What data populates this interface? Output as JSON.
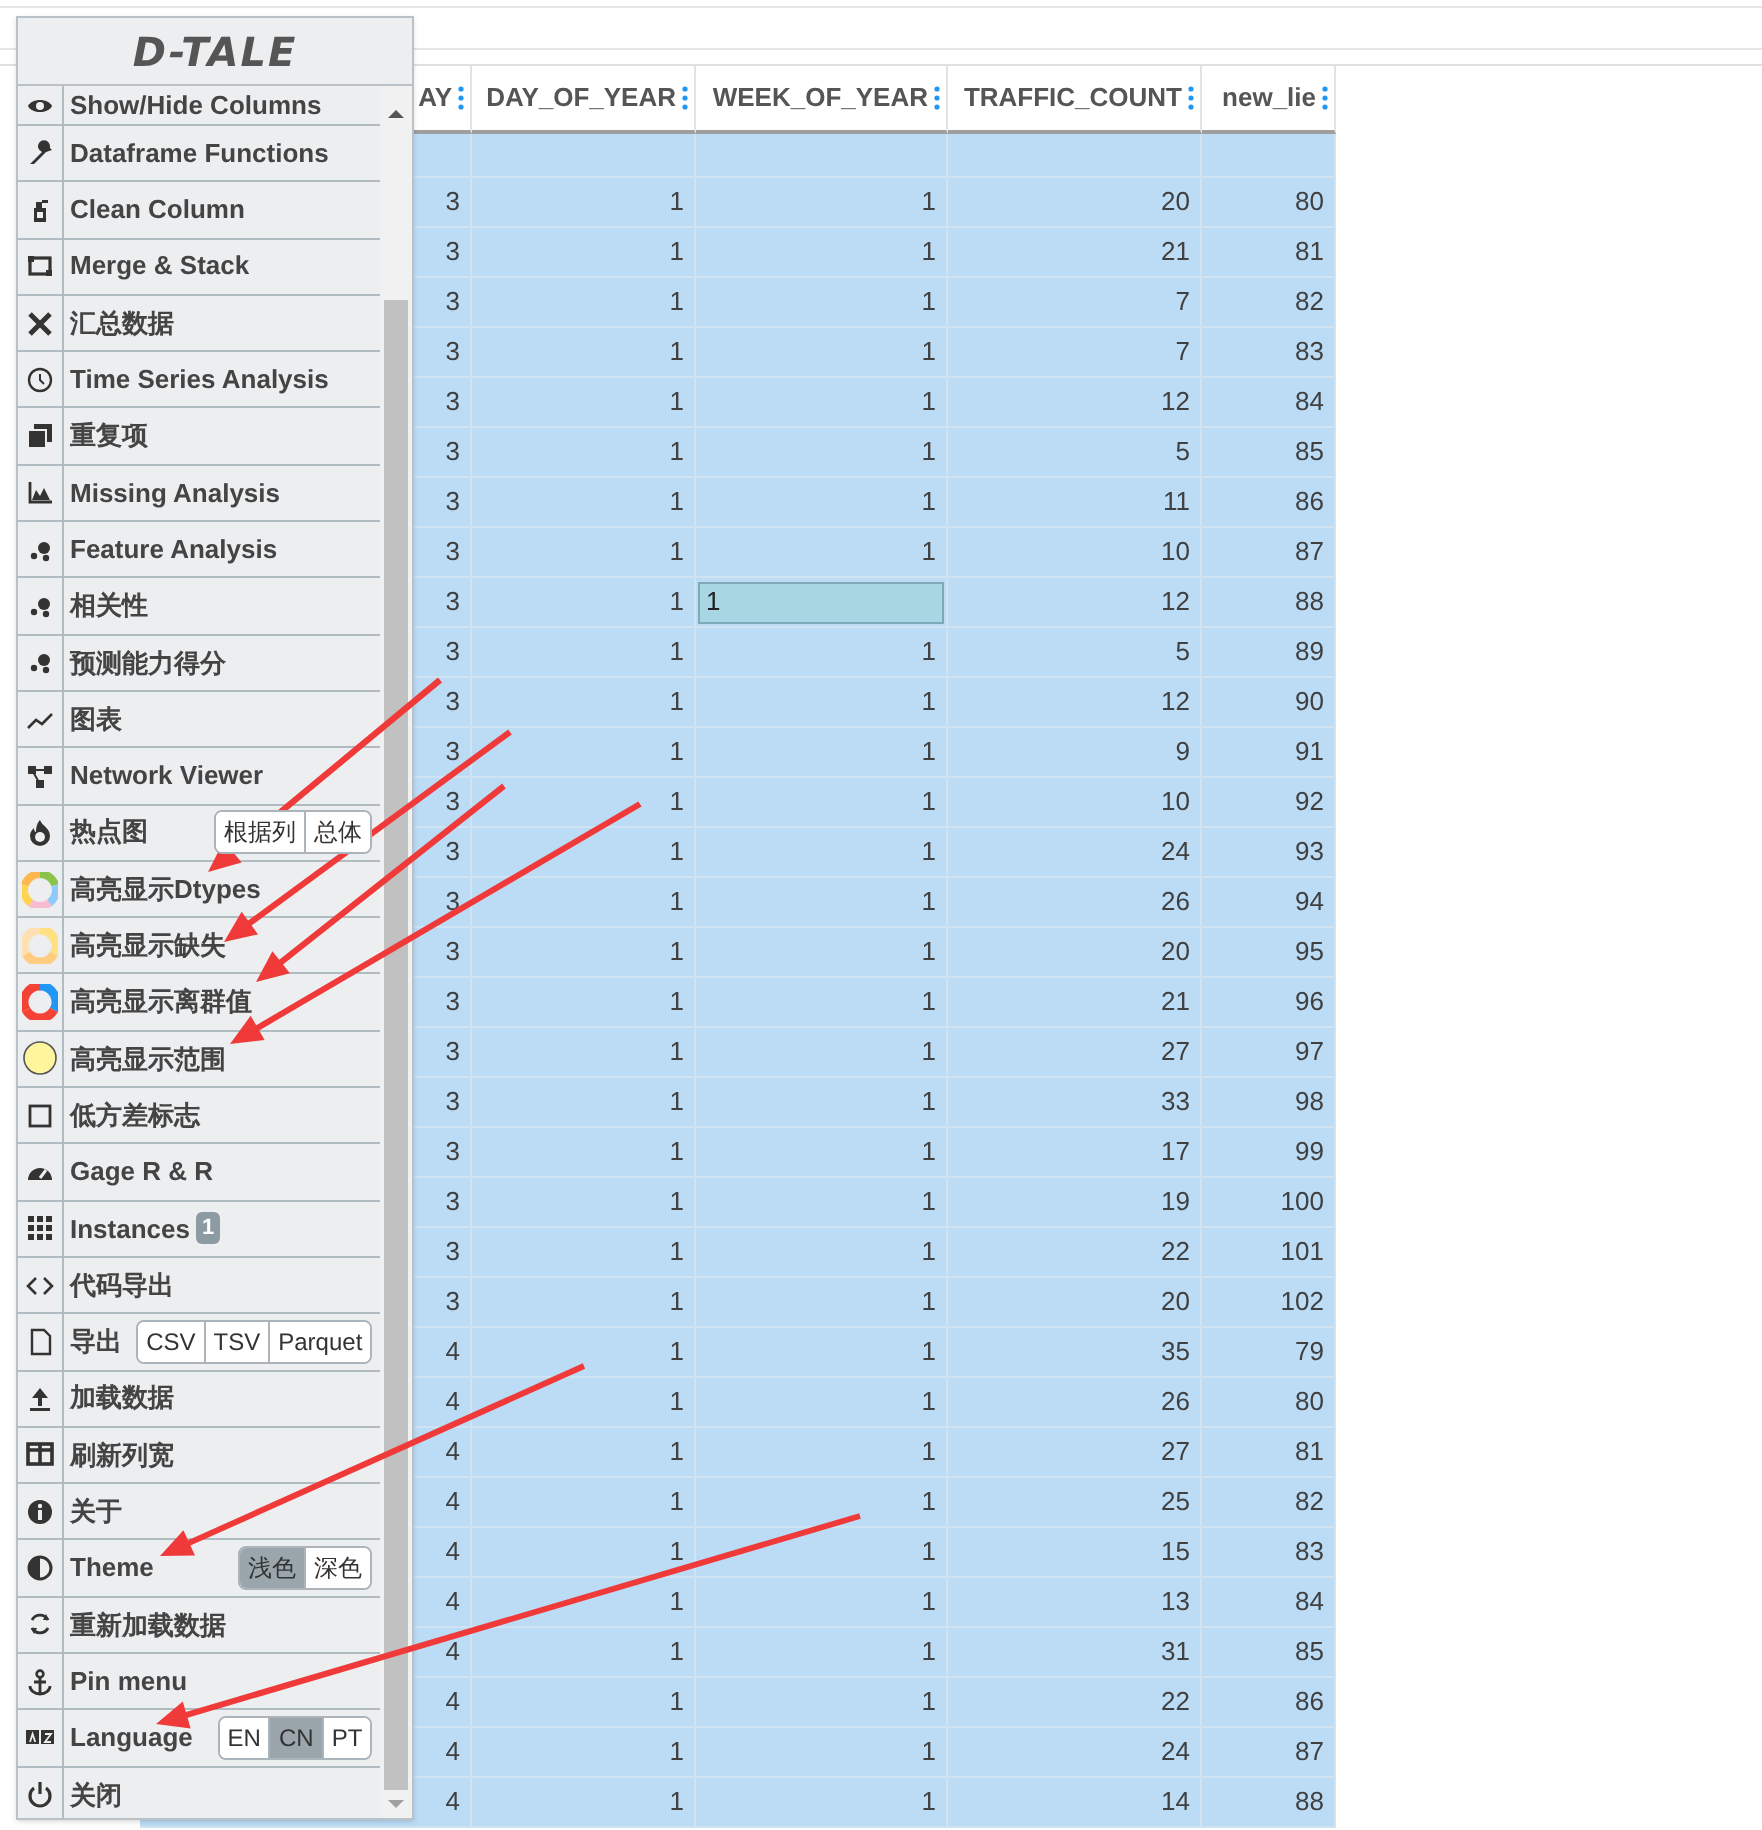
{
  "logo": "D-TALE",
  "menu": {
    "items": [
      {
        "label": "Show/Hide Columns"
      },
      {
        "label": "Dataframe Functions"
      },
      {
        "label": "Clean Column"
      },
      {
        "label": "Merge & Stack"
      },
      {
        "label": "汇总数据"
      },
      {
        "label": "Time Series Analysis"
      },
      {
        "label": "重复项"
      },
      {
        "label": "Missing Analysis"
      },
      {
        "label": "Feature Analysis"
      },
      {
        "label": "相关性"
      },
      {
        "label": "预测能力得分"
      },
      {
        "label": "图表"
      },
      {
        "label": "Network Viewer"
      },
      {
        "label": "热点图",
        "options": [
          {
            "label": "根据列",
            "selected": false
          },
          {
            "label": "总体",
            "selected": false
          }
        ]
      },
      {
        "label": "高亮显示Dtypes"
      },
      {
        "label": "高亮显示缺失"
      },
      {
        "label": "高亮显示离群值"
      },
      {
        "label": "高亮显示范围"
      },
      {
        "label": "低方差标志"
      },
      {
        "label": "Gage R & R"
      },
      {
        "label": "Instances",
        "badge": "1"
      },
      {
        "label": "代码导出"
      },
      {
        "label": "导出",
        "options": [
          {
            "label": "CSV",
            "selected": false
          },
          {
            "label": "TSV",
            "selected": false
          },
          {
            "label": "Parquet",
            "selected": false
          }
        ]
      },
      {
        "label": "加载数据"
      },
      {
        "label": "刷新列宽"
      },
      {
        "label": "关于"
      },
      {
        "label": "Theme",
        "options": [
          {
            "label": "浅色",
            "selected": true
          },
          {
            "label": "深色",
            "selected": false
          }
        ]
      },
      {
        "label": "重新加载数据"
      },
      {
        "label": "Pin menu"
      },
      {
        "label": "Language",
        "options": [
          {
            "label": "EN",
            "selected": false
          },
          {
            "label": "CN",
            "selected": true
          },
          {
            "label": "PT",
            "selected": false
          }
        ]
      },
      {
        "label": "关闭"
      }
    ]
  },
  "table": {
    "columns": [
      "AY",
      "DAY_OF_YEAR",
      "WEEK_OF_YEAR",
      "TRAFFIC_COUNT",
      "new_lie"
    ],
    "rows": [
      {
        "selected": true,
        "cells": [
          "3",
          "1",
          "1",
          "20",
          "80"
        ]
      },
      {
        "selected": true,
        "cells": [
          "3",
          "1",
          "1",
          "21",
          "81"
        ]
      },
      {
        "selected": true,
        "cells": [
          "3",
          "1",
          "1",
          "7",
          "82"
        ]
      },
      {
        "selected": true,
        "cells": [
          "3",
          "1",
          "1",
          "7",
          "83"
        ]
      },
      {
        "selected": true,
        "cells": [
          "3",
          "1",
          "1",
          "12",
          "84"
        ]
      },
      {
        "selected": true,
        "cells": [
          "3",
          "1",
          "1",
          "5",
          "85"
        ]
      },
      {
        "selected": true,
        "cells": [
          "3",
          "1",
          "1",
          "11",
          "86"
        ]
      },
      {
        "selected": true,
        "cells": [
          "3",
          "1",
          "1",
          "10",
          "87"
        ]
      },
      {
        "selected": true,
        "cells": [
          "3",
          "1",
          {
            "value": "1",
            "editing": true
          },
          "12",
          "88"
        ]
      },
      {
        "selected": true,
        "cells": [
          "3",
          "1",
          "1",
          "5",
          "89"
        ]
      },
      {
        "selected": true,
        "cells": [
          "3",
          "1",
          "1",
          "12",
          "90"
        ]
      },
      {
        "selected": true,
        "cells": [
          "3",
          "1",
          "1",
          "9",
          "91"
        ]
      },
      {
        "selected": true,
        "cells": [
          "3",
          "1",
          "1",
          "10",
          "92"
        ]
      },
      {
        "selected": true,
        "cells": [
          "3",
          "1",
          "1",
          "24",
          "93"
        ]
      },
      {
        "selected": true,
        "cells": [
          "3",
          "1",
          "1",
          "26",
          "94"
        ]
      },
      {
        "selected": true,
        "cells": [
          "3",
          "1",
          "1",
          "20",
          "95"
        ]
      },
      {
        "selected": true,
        "cells": [
          "3",
          "1",
          "1",
          "21",
          "96"
        ]
      },
      {
        "selected": true,
        "cells": [
          "3",
          "1",
          "1",
          "27",
          "97"
        ]
      },
      {
        "selected": true,
        "cells": [
          "3",
          "1",
          "1",
          "33",
          "98"
        ]
      },
      {
        "selected": true,
        "cells": [
          "3",
          "1",
          "1",
          "17",
          "99"
        ]
      },
      {
        "selected": true,
        "cells": [
          "3",
          "1",
          "1",
          "19",
          "100"
        ]
      },
      {
        "selected": true,
        "cells": [
          "3",
          "1",
          "1",
          "22",
          "101"
        ]
      },
      {
        "selected": true,
        "cells": [
          "3",
          "1",
          "1",
          "20",
          "102"
        ]
      },
      {
        "selected": true,
        "cells": [
          "4",
          "1",
          "1",
          "35",
          "79"
        ]
      },
      {
        "selected": true,
        "cells": [
          "4",
          "1",
          "1",
          "26",
          "80"
        ]
      },
      {
        "selected": true,
        "cells": [
          "4",
          "1",
          "1",
          "27",
          "81"
        ]
      },
      {
        "selected": true,
        "cells": [
          "4",
          "1",
          "1",
          "25",
          "82"
        ]
      },
      {
        "selected": true,
        "cells": [
          "4",
          "1",
          "1",
          "15",
          "83"
        ]
      },
      {
        "selected": true,
        "cells": [
          "4",
          "1",
          "1",
          "13",
          "84"
        ]
      },
      {
        "selected": true,
        "cells": [
          "4",
          "1",
          "1",
          "31",
          "85"
        ]
      },
      {
        "selected": true,
        "cells": [
          "4",
          "1",
          "1",
          "22",
          "86"
        ]
      },
      {
        "selected": true,
        "cells": [
          "4",
          "1",
          "1",
          "24",
          "87"
        ]
      },
      {
        "selected": true,
        "cells": [
          "4",
          "1",
          "1",
          "14",
          "88"
        ]
      }
    ]
  }
}
